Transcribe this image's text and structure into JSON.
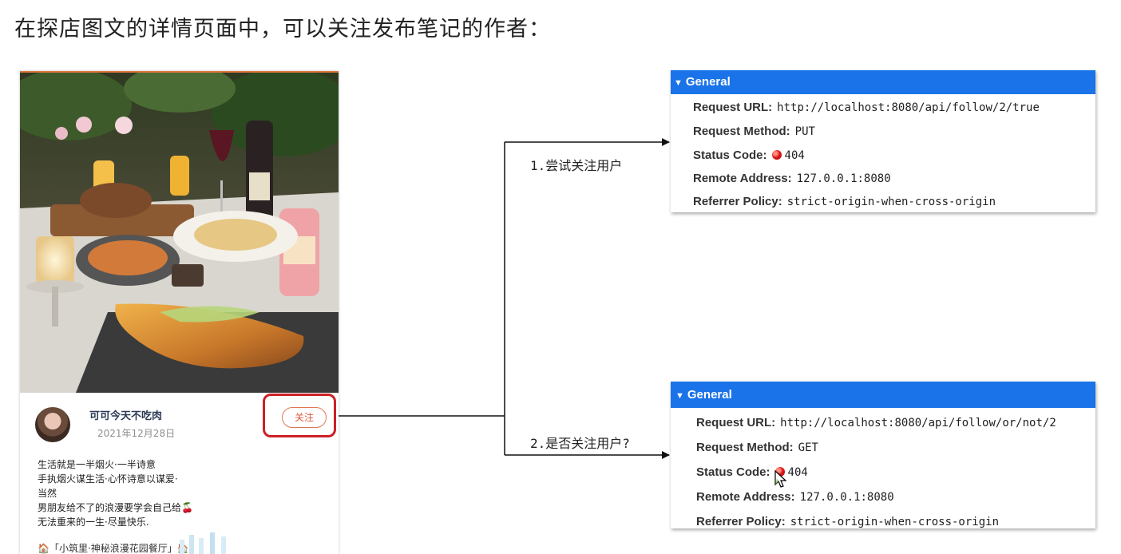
{
  "slide": {
    "title": "在探店图文的详情页面中，可以关注发布笔记的作者："
  },
  "post": {
    "author_name": "可可今天不吃肉",
    "date": "2021年12月28日",
    "follow_label": "关注",
    "body_lines": [
      "生活就是一半烟火·一半诗意",
      "手执烟火谋生活·心怀诗意以谋爱·",
      "当然",
      "男朋友给不了的浪漫要学会自己给🍒",
      "无法重来的一生·尽量快乐."
    ],
    "tag_line": "🏠「小筑里·神秘浪漫花园餐厅」🏠"
  },
  "steps": {
    "step1": "1.尝试关注用户",
    "step2": "2.是否关注用户?"
  },
  "panel1": {
    "header": "General",
    "request_url_label": "Request URL:",
    "request_url": "http://localhost:8080/api/follow/2/true",
    "request_method_label": "Request Method:",
    "request_method": "PUT",
    "status_code_label": "Status Code:",
    "status_code": "404",
    "remote_address_label": "Remote Address:",
    "remote_address": "127.0.0.1:8080",
    "referrer_policy_label": "Referrer Policy:",
    "referrer_policy": "strict-origin-when-cross-origin"
  },
  "panel2": {
    "header": "General",
    "request_url_label": "Request URL:",
    "request_url": "http://localhost:8080/api/follow/or/not/2",
    "request_method_label": "Request Method:",
    "request_method": "GET",
    "status_code_label": "Status Code:",
    "status_code": "404",
    "remote_address_label": "Remote Address:",
    "remote_address": "127.0.0.1:8080",
    "referrer_policy_label": "Referrer Policy:",
    "referrer_policy": "strict-origin-when-cross-origin"
  },
  "colors": {
    "devtools_header": "#1a73e8",
    "highlight_red": "#cc2026",
    "status_error": "#e01b1b",
    "follow_accent": "#d95b3c"
  }
}
